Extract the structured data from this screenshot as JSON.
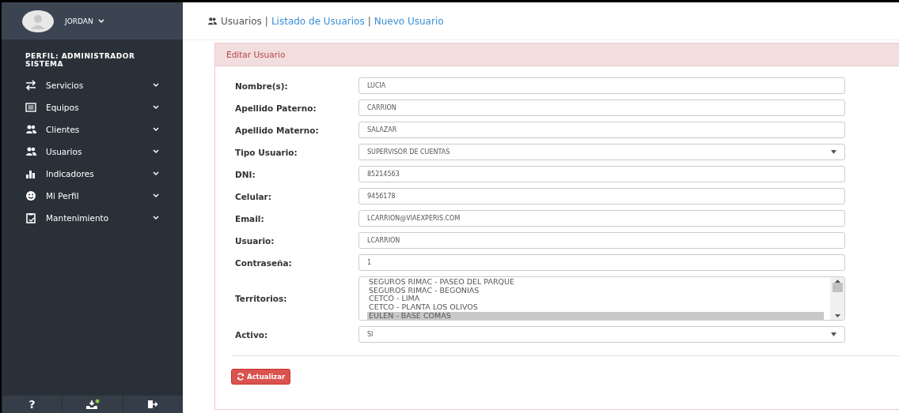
{
  "user": {
    "name": "JORDAN"
  },
  "profile": "PERFIL: ADMINISTRADOR SISTEMA",
  "sidebar": {
    "items": [
      {
        "label": "Servicios",
        "expanded": false
      },
      {
        "label": "Equipos",
        "expanded": false
      },
      {
        "label": "Clientes",
        "expanded": false
      },
      {
        "label": "Usuarios",
        "expanded": false
      },
      {
        "label": "Indicadores",
        "expanded": false
      },
      {
        "label": "Mi Perfil",
        "expanded": false
      },
      {
        "label": "Mantenimiento",
        "expanded": false
      }
    ]
  },
  "footer": {
    "help": "?",
    "notification": true
  },
  "breadcrumb": {
    "current": "Usuarios",
    "links": [
      "Listado de Usuarios",
      "Nuevo Usuario"
    ],
    "separator": "|"
  },
  "panel": {
    "title": "Editar Usuario",
    "fields": [
      {
        "kind": "text",
        "label": "Nombre(s):",
        "value": "LUCIA"
      },
      {
        "kind": "text",
        "label": "Apellido Paterno:",
        "value": "CARRION"
      },
      {
        "kind": "text",
        "label": "Apellido Materno:",
        "value": "SALAZAR"
      },
      {
        "kind": "select",
        "label": "Tipo Usuario:",
        "value": "SUPERVISOR DE CUENTAS"
      },
      {
        "kind": "text",
        "label": "DNI:",
        "value": "85214563"
      },
      {
        "kind": "text",
        "label": "Celular:",
        "value": "9456178"
      },
      {
        "kind": "text",
        "label": "Email:",
        "value": "LCARRION@VIAEXPERIS.COM"
      },
      {
        "kind": "text",
        "label": "Usuario:",
        "value": "LCARRION"
      },
      {
        "kind": "text",
        "label": "Contraseña:",
        "value": "1"
      },
      {
        "kind": "listbox",
        "label": "Territorios:",
        "options": [
          {
            "label": "SEGUROS RIMAC - PASEO DEL PARQUE",
            "selected": false
          },
          {
            "label": "SEGUROS RIMAC - BEGONIAS",
            "selected": false
          },
          {
            "label": "CETCO - LIMA",
            "selected": false
          },
          {
            "label": "CETCO - PLANTA LOS OLIVOS",
            "selected": false
          },
          {
            "label": "EULEN - BASE COMAS",
            "selected": true
          }
        ]
      },
      {
        "kind": "select",
        "label": "Activo:",
        "value": "SI"
      }
    ],
    "submit": "Actualizar"
  }
}
